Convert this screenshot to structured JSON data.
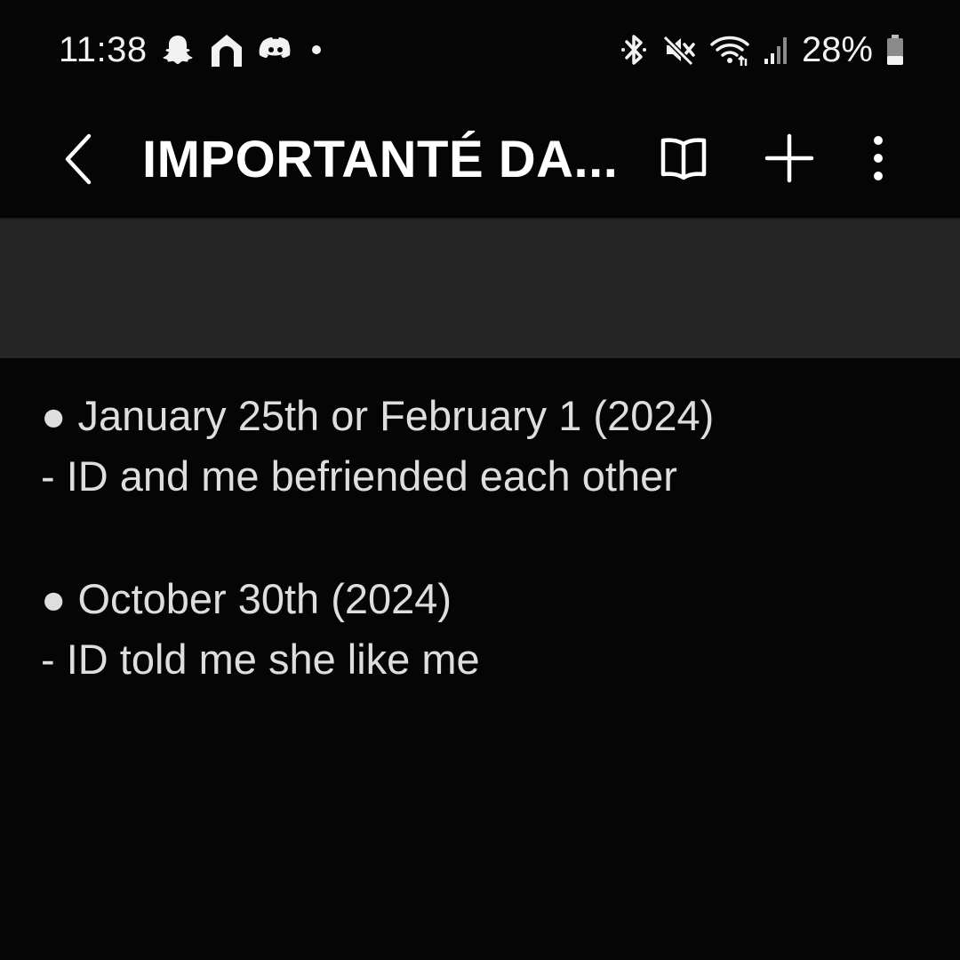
{
  "status_bar": {
    "time": "11:38",
    "battery_percent": "28%",
    "left_icons": [
      "snapchat-icon",
      "home-icon",
      "discord-icon",
      "dot-icon"
    ],
    "right_icons": [
      "bluetooth-icon",
      "mute-icon",
      "wifi-icon",
      "signal-icon",
      "battery-icon"
    ]
  },
  "app_bar": {
    "title": "IMPORTANTÉ DA...",
    "icons": [
      "back-arrow-icon",
      "book-icon",
      "plus-icon",
      "more-vert-icon"
    ]
  },
  "note": {
    "lines": [
      "● January 25th or February 1 (2024)",
      "- ID and me befriended each other",
      "",
      "● October 30th (2024)",
      "- ID told me she like me"
    ]
  },
  "colors": {
    "background": "#050505",
    "band": "#262626",
    "text": "#dedede"
  }
}
